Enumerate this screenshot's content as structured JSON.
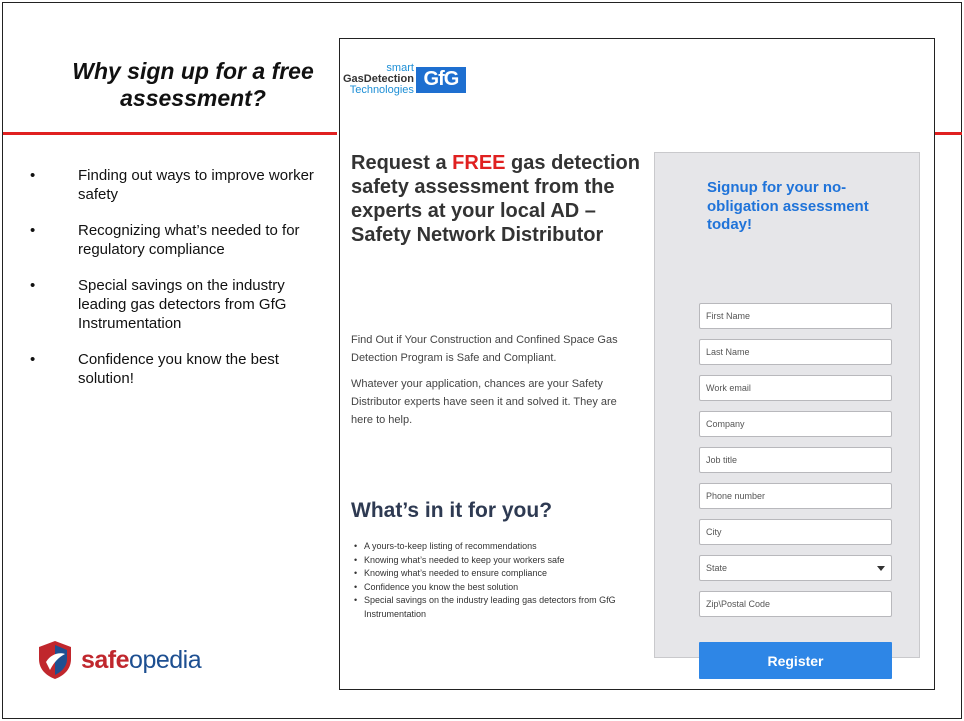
{
  "slide": {
    "title": "Why sign up for a free assessment?",
    "bullets": [
      "Finding out ways to improve worker safety",
      "Recognizing what’s needed to for regulatory compliance",
      "Special savings on the industry leading gas detectors from GfG Instrumentation",
      "Confidence you know the best solution!"
    ],
    "bullet_glyph": "•",
    "brand": {
      "part_a": "safe",
      "part_b": "opedia",
      "icon": "shield-icon"
    }
  },
  "landing": {
    "logo": {
      "smart": "smart",
      "gas": "GasDetection",
      "tech": "Technologies",
      "mark": "GfG"
    },
    "heading_pre": "Request a ",
    "heading_free": "FREE",
    "heading_post": " gas detection safety assessment from the experts at your local AD – Safety Network Distributor",
    "para1": "Find Out if Your Construction and Confined Space Gas Detection Program is Safe and Compliant.",
    "para2": "Whatever your application, chances are your Safety Distributor experts have seen it and solved it. They are here to help.",
    "wit_title": "What’s in it for you?",
    "wit_items": [
      "A yours-to-keep listing of recommendations",
      "Knowing what’s needed to keep your workers safe",
      "Knowing what’s needed to ensure compliance",
      "Confidence you know the best solution",
      "Special savings on the industry leading gas detectors from GfG Instrumentation"
    ]
  },
  "form": {
    "heading": "Signup for your no-obligation assessment today!",
    "fields": [
      "First Name",
      "Last Name",
      "Work email",
      "Company",
      "Job title",
      "Phone number",
      "City",
      "State",
      "Zip\\Postal Code"
    ],
    "register_label": "Register"
  },
  "colors": {
    "accent_red": "#e02020",
    "accent_blue": "#1f73d9",
    "button_blue": "#2e86e6"
  }
}
